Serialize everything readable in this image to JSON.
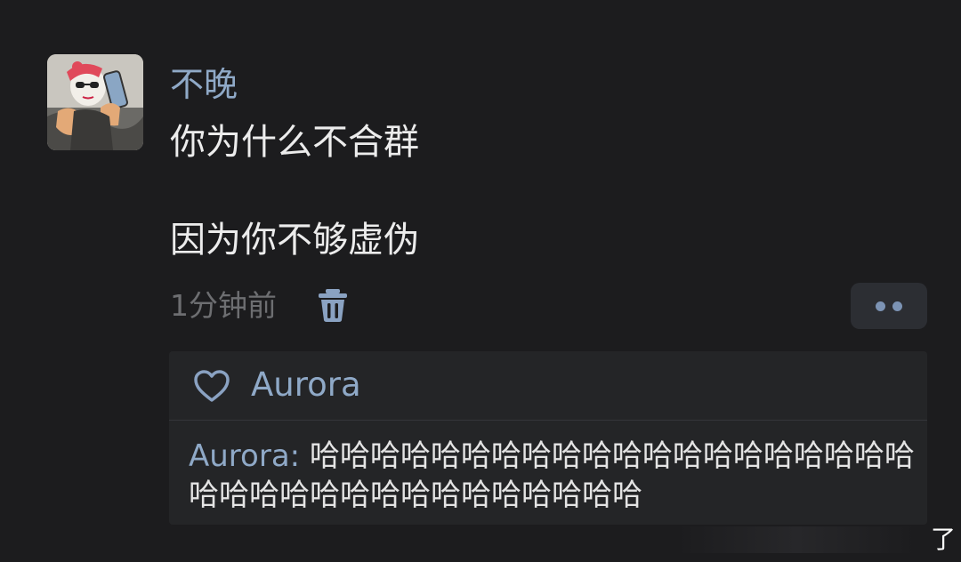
{
  "post": {
    "username": "不晚",
    "line1": "你为什么不合群",
    "line2": "因为你不够虚伪",
    "timestamp": "1分钟前"
  },
  "likes": {
    "names": "Aurora"
  },
  "comment": {
    "author": "Aurora:",
    "text": " 哈哈哈哈哈哈哈哈哈哈哈哈哈哈哈哈哈哈哈哈哈哈哈哈哈哈哈哈哈哈哈哈哈哈哈"
  },
  "corner": {
    "glyph": "了"
  },
  "colors": {
    "background": "#1c1c1e",
    "name_blue": "#8fa9c7",
    "body_text": "#ececec",
    "muted": "#6d6e71",
    "panel": "#242527"
  },
  "icons": {
    "delete": "trash-icon",
    "more": "more-dots-icon",
    "like": "heart-outline-icon"
  }
}
